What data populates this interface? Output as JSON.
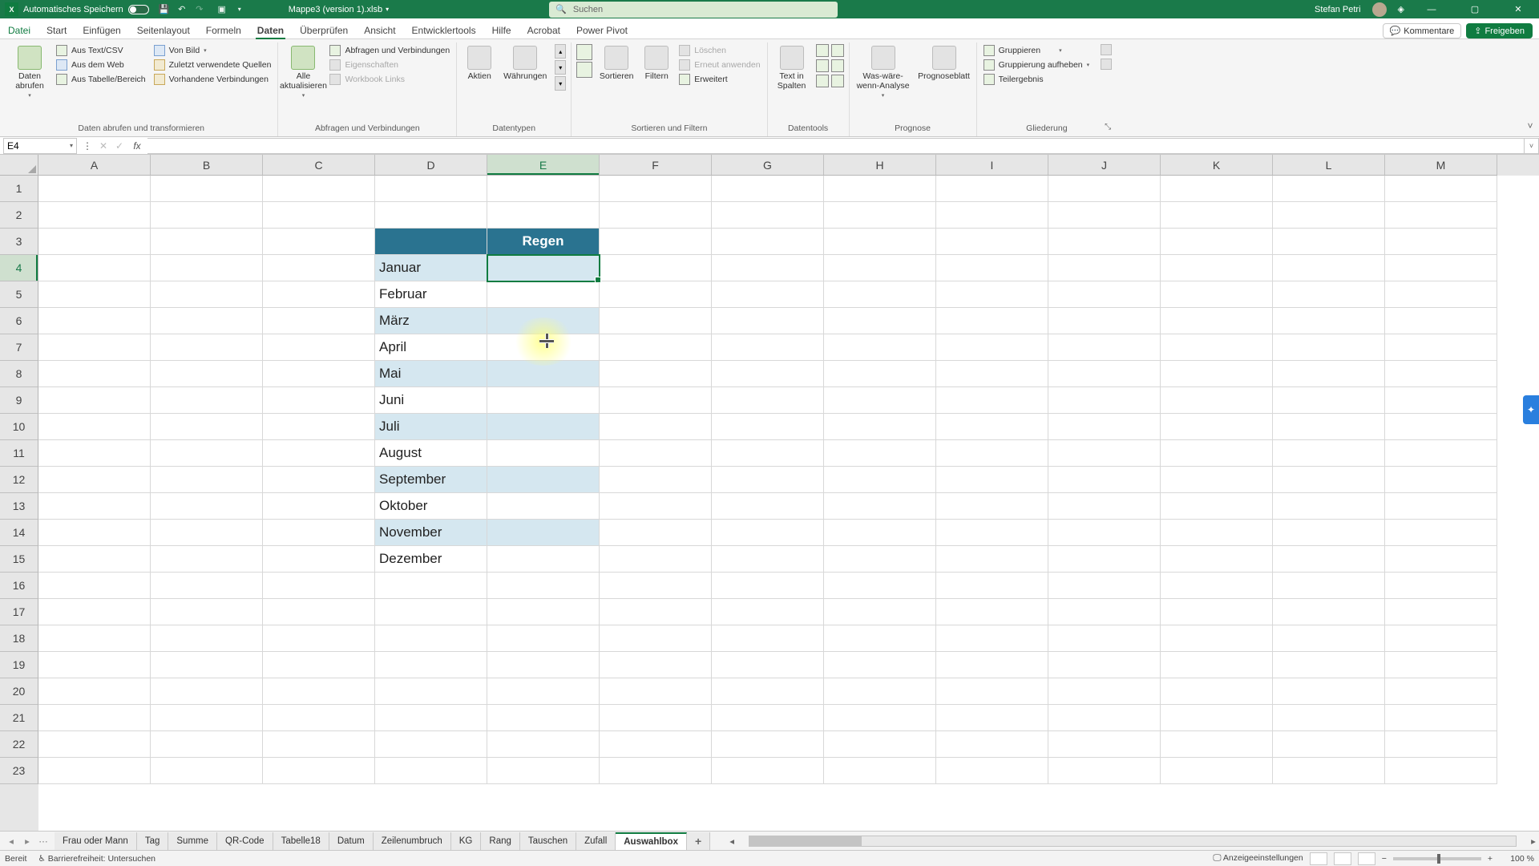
{
  "titlebar": {
    "autosave_label": "Automatisches Speichern",
    "doc_title": "Mappe3 (version 1).xlsb",
    "search_placeholder": "Suchen",
    "user_name": "Stefan Petri"
  },
  "menu": {
    "tabs": [
      "Datei",
      "Start",
      "Einfügen",
      "Seitenlayout",
      "Formeln",
      "Daten",
      "Überprüfen",
      "Ansicht",
      "Entwicklertools",
      "Hilfe",
      "Acrobat",
      "Power Pivot"
    ],
    "active_index": 5,
    "comments_label": "Kommentare",
    "share_label": "Freigeben"
  },
  "ribbon": {
    "groups": {
      "get_data": {
        "big": "Daten abrufen",
        "items": [
          "Aus Text/CSV",
          "Aus dem Web",
          "Aus Tabelle/Bereich",
          "Von Bild",
          "Zuletzt verwendete Quellen",
          "Vorhandene Verbindungen"
        ],
        "label": "Daten abrufen und transformieren"
      },
      "queries": {
        "big": "Alle aktualisieren",
        "items": [
          "Abfragen und Verbindungen",
          "Eigenschaften",
          "Workbook Links"
        ],
        "disabled": [
          false,
          true,
          true
        ],
        "label": "Abfragen und Verbindungen"
      },
      "datatypes": {
        "items": [
          "Aktien",
          "Währungen"
        ],
        "label": "Datentypen"
      },
      "sort": {
        "sort": "Sortieren",
        "filter": "Filtern",
        "clear": "Löschen",
        "reapply": "Erneut anwenden",
        "advanced": "Erweitert",
        "label": "Sortieren und Filtern"
      },
      "datatools": {
        "ttc": "Text in Spalten",
        "label": "Datentools"
      },
      "forecast": {
        "whatif": "Was-wäre-wenn-Analyse",
        "sheet": "Prognoseblatt",
        "label": "Prognose"
      },
      "outline": {
        "group": "Gruppieren",
        "ungroup": "Gruppierung aufheben",
        "subtotal": "Teilergebnis",
        "label": "Gliederung"
      }
    }
  },
  "formula_bar": {
    "name_box": "E4",
    "formula": ""
  },
  "grid": {
    "columns": [
      "A",
      "B",
      "C",
      "D",
      "E",
      "F",
      "G",
      "H",
      "I",
      "J",
      "K",
      "L",
      "M"
    ],
    "selected_col": "E",
    "row_count": 23,
    "selected_row": 4,
    "table": {
      "header_col": "D",
      "header_row": 3,
      "header_text": "Regen",
      "months": [
        "Januar",
        "Februar",
        "März",
        "April",
        "Mai",
        "Juni",
        "Juli",
        "August",
        "September",
        "Oktober",
        "November",
        "Dezember"
      ]
    },
    "cursor_highlight": {
      "col": "E",
      "row_between": 7
    }
  },
  "sheets": {
    "tabs": [
      "Frau oder Mann",
      "Tag",
      "Summe",
      "QR-Code",
      "Tabelle18",
      "Datum",
      "Zeilenumbruch",
      "KG",
      "Rang",
      "Tauschen",
      "Zufall",
      "Auswahlbox"
    ],
    "active_index": 11
  },
  "statusbar": {
    "ready": "Bereit",
    "accessibility": "Barrierefreiheit: Untersuchen",
    "display_settings": "Anzeigeeinstellungen",
    "zoom": "100 %"
  }
}
